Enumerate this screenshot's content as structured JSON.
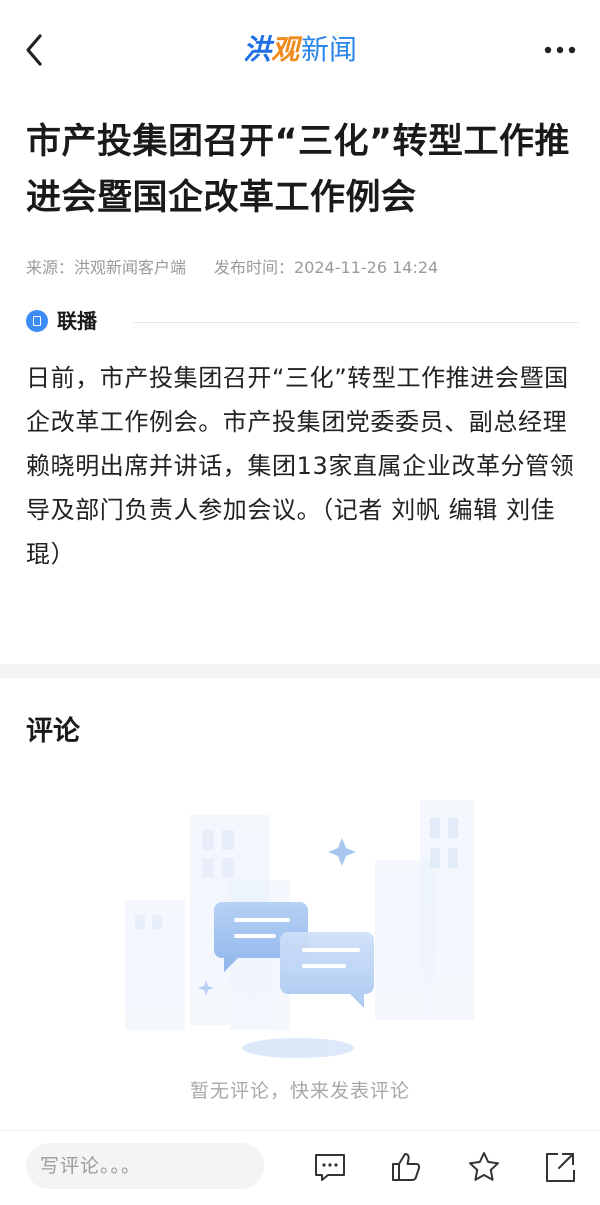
{
  "header": {
    "logo_part1": "洪",
    "logo_part2": "观",
    "logo_part3": "新闻",
    "back_icon": "chevron-left-icon",
    "more_icon": "more-horizontal-icon"
  },
  "article": {
    "title": "市产投集团召开“三化”转型工作推进会暨国企改革工作例会",
    "source": "来源：洪观新闻客户端",
    "publish_time": "发布时间：2024-11-26 14:24",
    "section_label": "联播",
    "body": "日前，市产投集团召开“三化”转型工作推进会暨国企改革工作例会。市产投集团党委委员、副总经理赖晓明出席并讲话，集团13家直属企业改革分管领导及部门负责人参加会议。（记者 刘帆 编辑 刘佳琨）"
  },
  "comments": {
    "title": "评论",
    "empty_text": "暂无评论，快来发表评论"
  },
  "bottom_bar": {
    "input_placeholder": "写评论。。。",
    "icons": [
      "comment-icon",
      "like-icon",
      "star-icon",
      "share-icon"
    ]
  },
  "colors": {
    "accent": "#2a86e8",
    "logo_orange": "#f08a1c",
    "muted_text": "#9a9a9a"
  }
}
